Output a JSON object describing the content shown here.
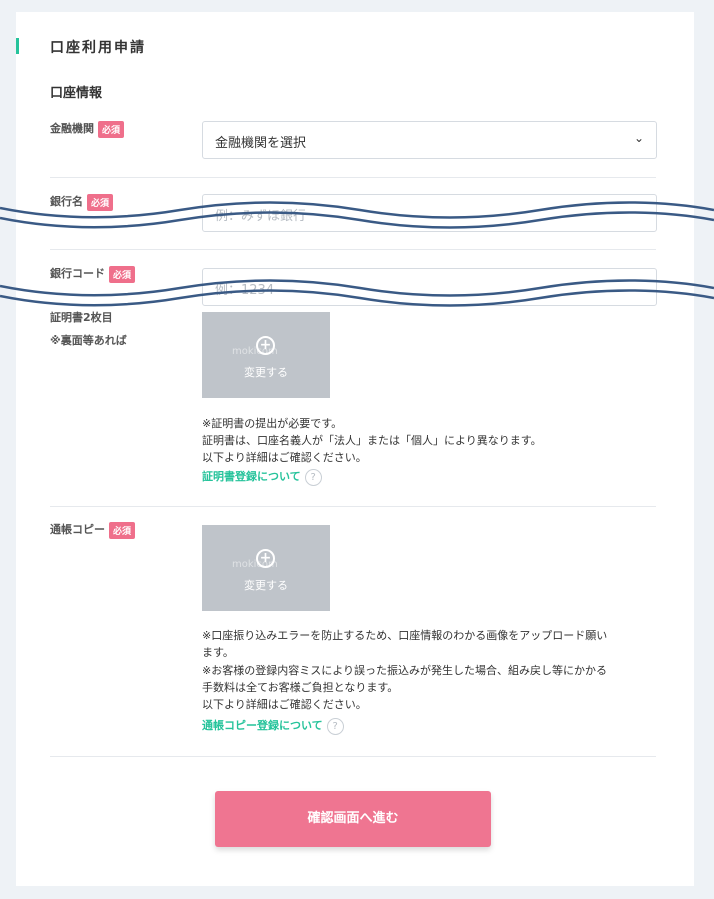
{
  "page_title": "口座利用申請",
  "section_title": "口座情報",
  "required_badge": "必須",
  "fields": {
    "institution": {
      "label": "金融機関",
      "value": "金融機関を選択"
    },
    "bank_name": {
      "label": "銀行名",
      "placeholder": "例：みずほ銀行"
    },
    "bank_code": {
      "label": "銀行コード",
      "placeholder": "例：1234"
    },
    "certificate2": {
      "label": "証明書2枚目",
      "sublabel": "※裏面等あれば",
      "upload_label": "変更する",
      "watermark": "mokicom",
      "notes": [
        "※証明書の提出が必要です。",
        "証明書は、口座名義人が「法人」または「個人」により異なります。",
        "以下より詳細はご確認ください。"
      ],
      "link": "証明書登録について"
    },
    "passbook": {
      "label": "通帳コピー",
      "upload_label": "変更する",
      "watermark": "mokicom",
      "notes": [
        "※口座振り込みエラーを防止するため、口座情報のわかる画像をアップロード願い",
        "ます。",
        "※お客様の登録内容ミスにより誤った振込みが発生した場合、組み戻し等にかかる",
        "手数料は全てお客様ご負担となります。",
        "以下より詳細はご確認ください。"
      ],
      "link": "通帳コピー登録について"
    }
  },
  "help_icon": "question-circle-icon",
  "submit_label": "確認画面へ進む",
  "colors": {
    "accent": "#26c39b",
    "badge": "#ef6f8b",
    "submit": "#ef7591",
    "upload_bg": "#bfc4ca",
    "wave": "#3a5a85"
  }
}
